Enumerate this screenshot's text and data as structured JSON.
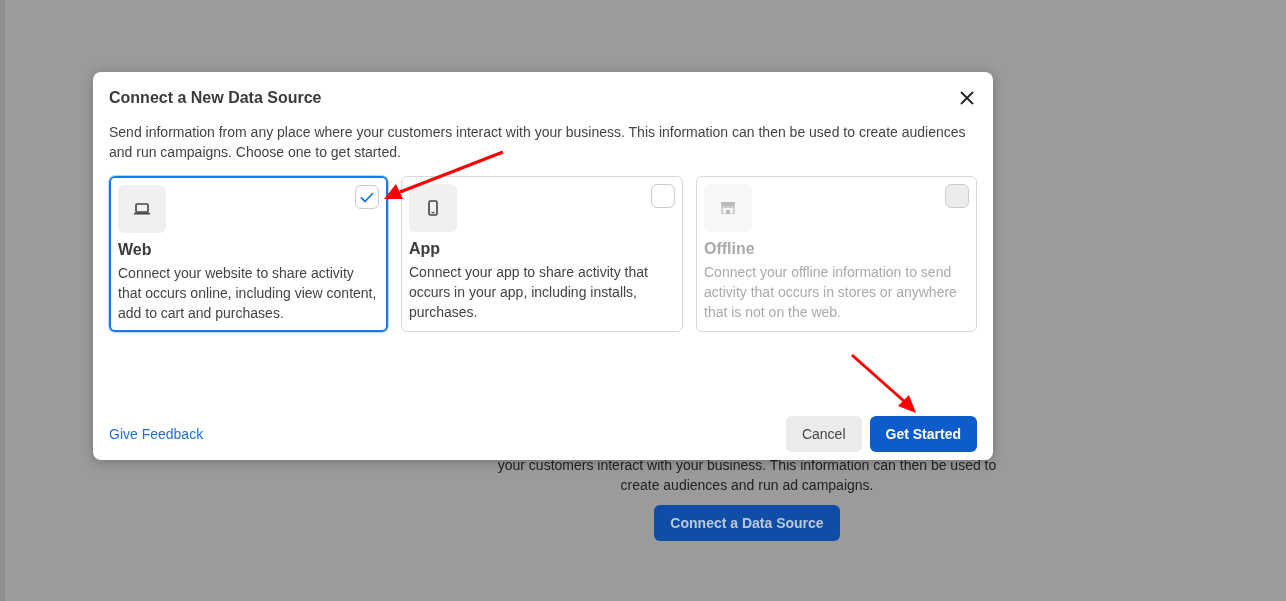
{
  "background": {
    "text": "your customers interact with your business. This information can then be used to create audiences and run ad campaigns.",
    "button": "Connect a Data Source"
  },
  "dialog": {
    "title": "Connect a New Data Source",
    "description": "Send information from any place where your customers interact with your business. This information can then be used to create audiences and run campaigns. Choose one to get started.",
    "options": [
      {
        "kind": "web",
        "title": "Web",
        "description": "Connect your website to share activity that occurs online, including view content, add to cart and purchases.",
        "selected": true,
        "disabled": false
      },
      {
        "kind": "app",
        "title": "App",
        "description": "Connect your app to share activity that occurs in your app, including installs, purchases.",
        "selected": false,
        "disabled": false
      },
      {
        "kind": "offline",
        "title": "Offline",
        "description": "Connect your offline information to send activity that occurs in stores or anywhere that is not on the web.",
        "selected": false,
        "disabled": true
      }
    ],
    "feedback_link": "Give Feedback",
    "buttons": [
      {
        "kind": "secondary",
        "label": "Cancel"
      },
      {
        "kind": "primary",
        "label": "Get Started"
      }
    ]
  }
}
